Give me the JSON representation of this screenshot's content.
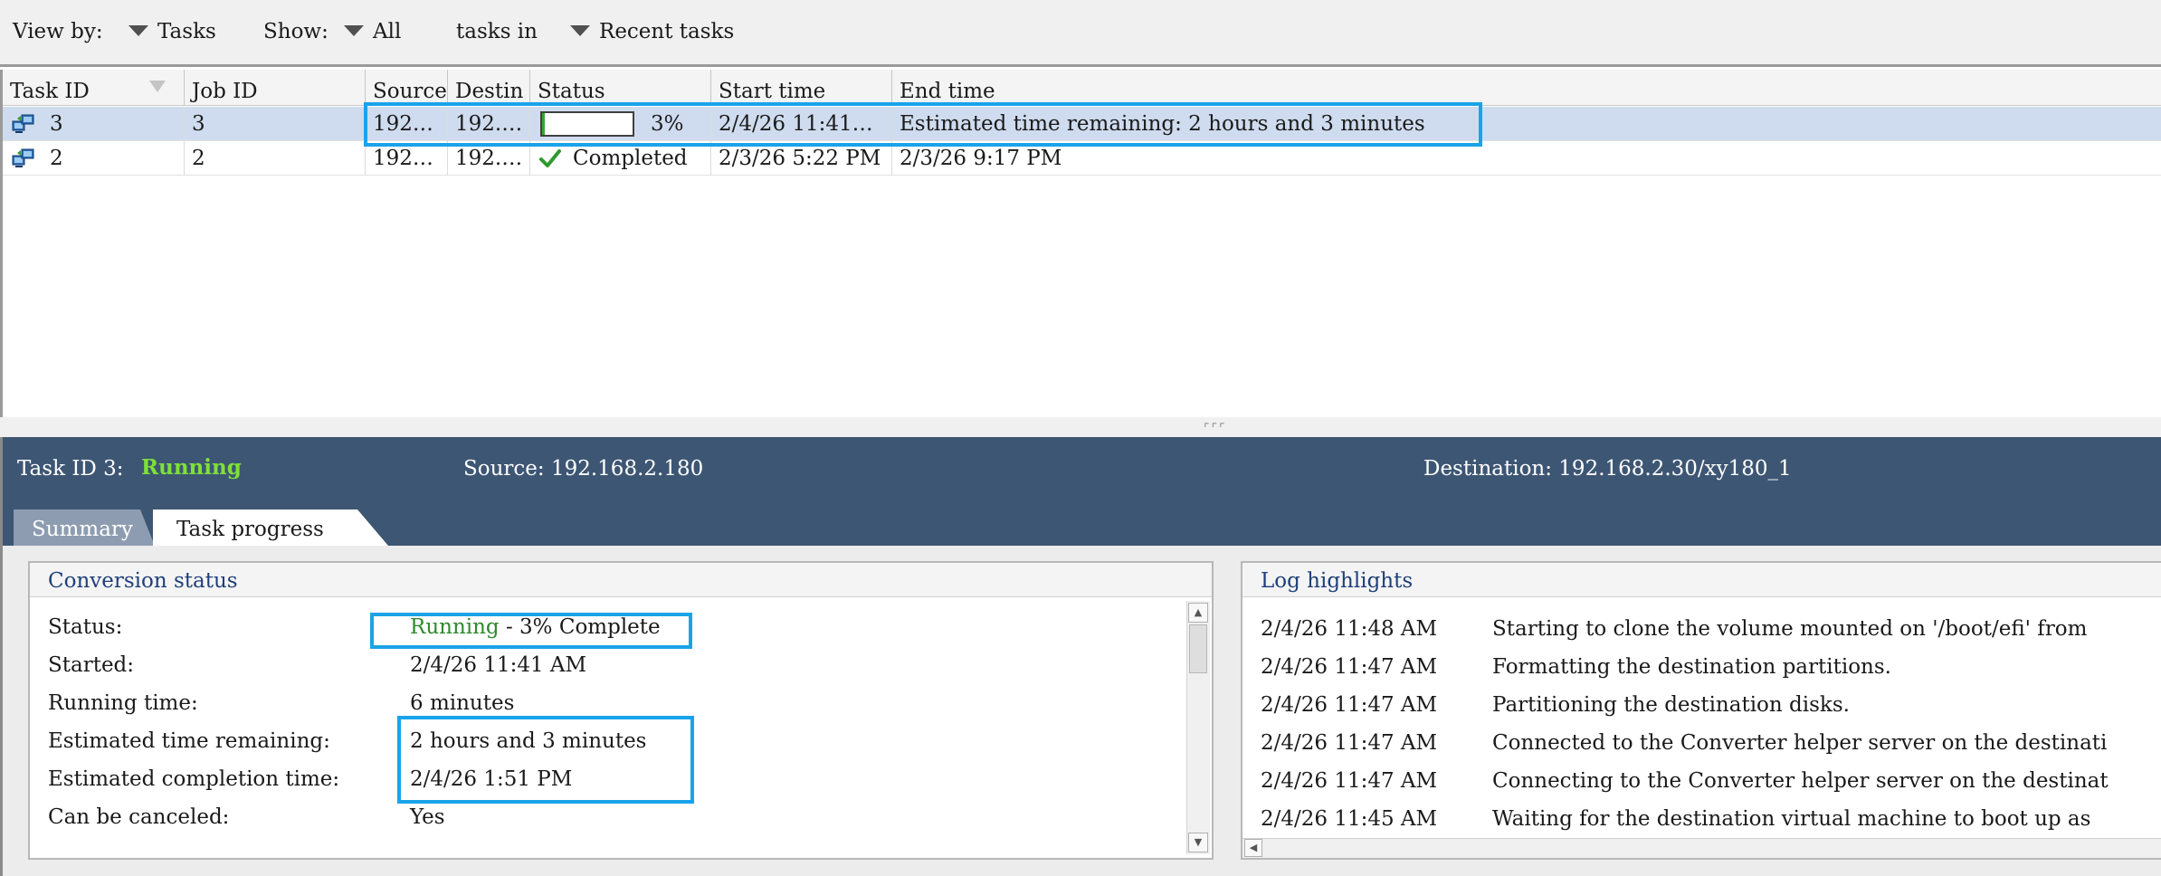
{
  "toolbar": {
    "view_by_label": "View by:",
    "view_by_value": "Tasks",
    "show_label": "Show:",
    "show_value": "All",
    "tasks_in_label": "tasks in",
    "tasks_in_value": "Recent tasks"
  },
  "grid": {
    "columns": [
      "Task ID",
      "Job ID",
      "Source",
      "Destin",
      "Status",
      "Start time",
      "End time"
    ],
    "rows": [
      {
        "task_id": "3",
        "job_id": "3",
        "source": "192…",
        "destination": "192.…",
        "status_progress_label": "3%",
        "progress_percent": 3,
        "start_time": "2/4/26 11:41…",
        "end_time": "Estimated time remaining: 2 hours and 3 minutes",
        "selected": true
      },
      {
        "task_id": "2",
        "job_id": "2",
        "source": "192…",
        "destination": "192.…",
        "status": "Completed",
        "start_time": "2/3/26 5:22 PM",
        "end_time": "2/3/26 9:17 PM",
        "selected": false
      }
    ]
  },
  "detail": {
    "task_label": "Task ID 3:",
    "task_state": "Running",
    "source": "Source: 192.168.2.180",
    "destination": "Destination: 192.168.2.30/xy180_1",
    "tabs": [
      "Summary",
      "Task progress"
    ],
    "active_tab": "Task progress"
  },
  "conversion": {
    "title": "Conversion status",
    "status_label": "Status:",
    "status_running": "Running",
    "status_rest": " - 3% Complete",
    "started_label": "Started:",
    "started_value": "2/4/26 11:41 AM",
    "running_label": "Running time:",
    "running_value": "6 minutes",
    "remaining_label": "Estimated time remaining:",
    "remaining_value": "2 hours and 3 minutes",
    "completion_label": "Estimated completion time:",
    "completion_value": "2/4/26 1:51 PM",
    "cancel_label": "Can be canceled:",
    "cancel_value": "Yes"
  },
  "log": {
    "title": "Log highlights",
    "entries": [
      {
        "time": "2/4/26 11:48 AM",
        "message": "Starting to clone the volume mounted on '/boot/efi' from"
      },
      {
        "time": "2/4/26 11:47 AM",
        "message": "Formatting the destination partitions."
      },
      {
        "time": "2/4/26 11:47 AM",
        "message": "Partitioning the destination disks."
      },
      {
        "time": "2/4/26 11:47 AM",
        "message": "Connected to the Converter helper server on the destinati"
      },
      {
        "time": "2/4/26 11:47 AM",
        "message": "Connecting to the Converter helper server on the destinat"
      },
      {
        "time": "2/4/26 11:45 AM",
        "message": "Waiting for the destination virtual machine to boot up as"
      }
    ]
  },
  "colors": {
    "highlight": "#1aa3e8",
    "panel_bg": "#3d5673",
    "running_green": "#7ee03a",
    "selected_row": "#cfdcef"
  }
}
